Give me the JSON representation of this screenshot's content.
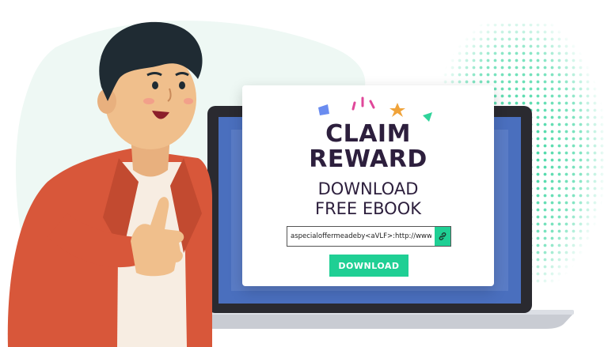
{
  "card": {
    "title_line1": "CLAIM",
    "title_line2": "REWARD",
    "subtitle_line1": "DOWNLOAD",
    "subtitle_line2": "FREE EBOOK",
    "link_value": "aspecialoffermeadeby<aVLF>:http://www.viralle",
    "download_label": "DOWNLOAD"
  },
  "icons": {
    "copy": "link-icon"
  },
  "colors": {
    "accent": "#1fcf94",
    "title": "#2d1f3d",
    "screen": "#4a6fbe",
    "jacket": "#d8573a",
    "background_blob": "#eef8f4"
  }
}
